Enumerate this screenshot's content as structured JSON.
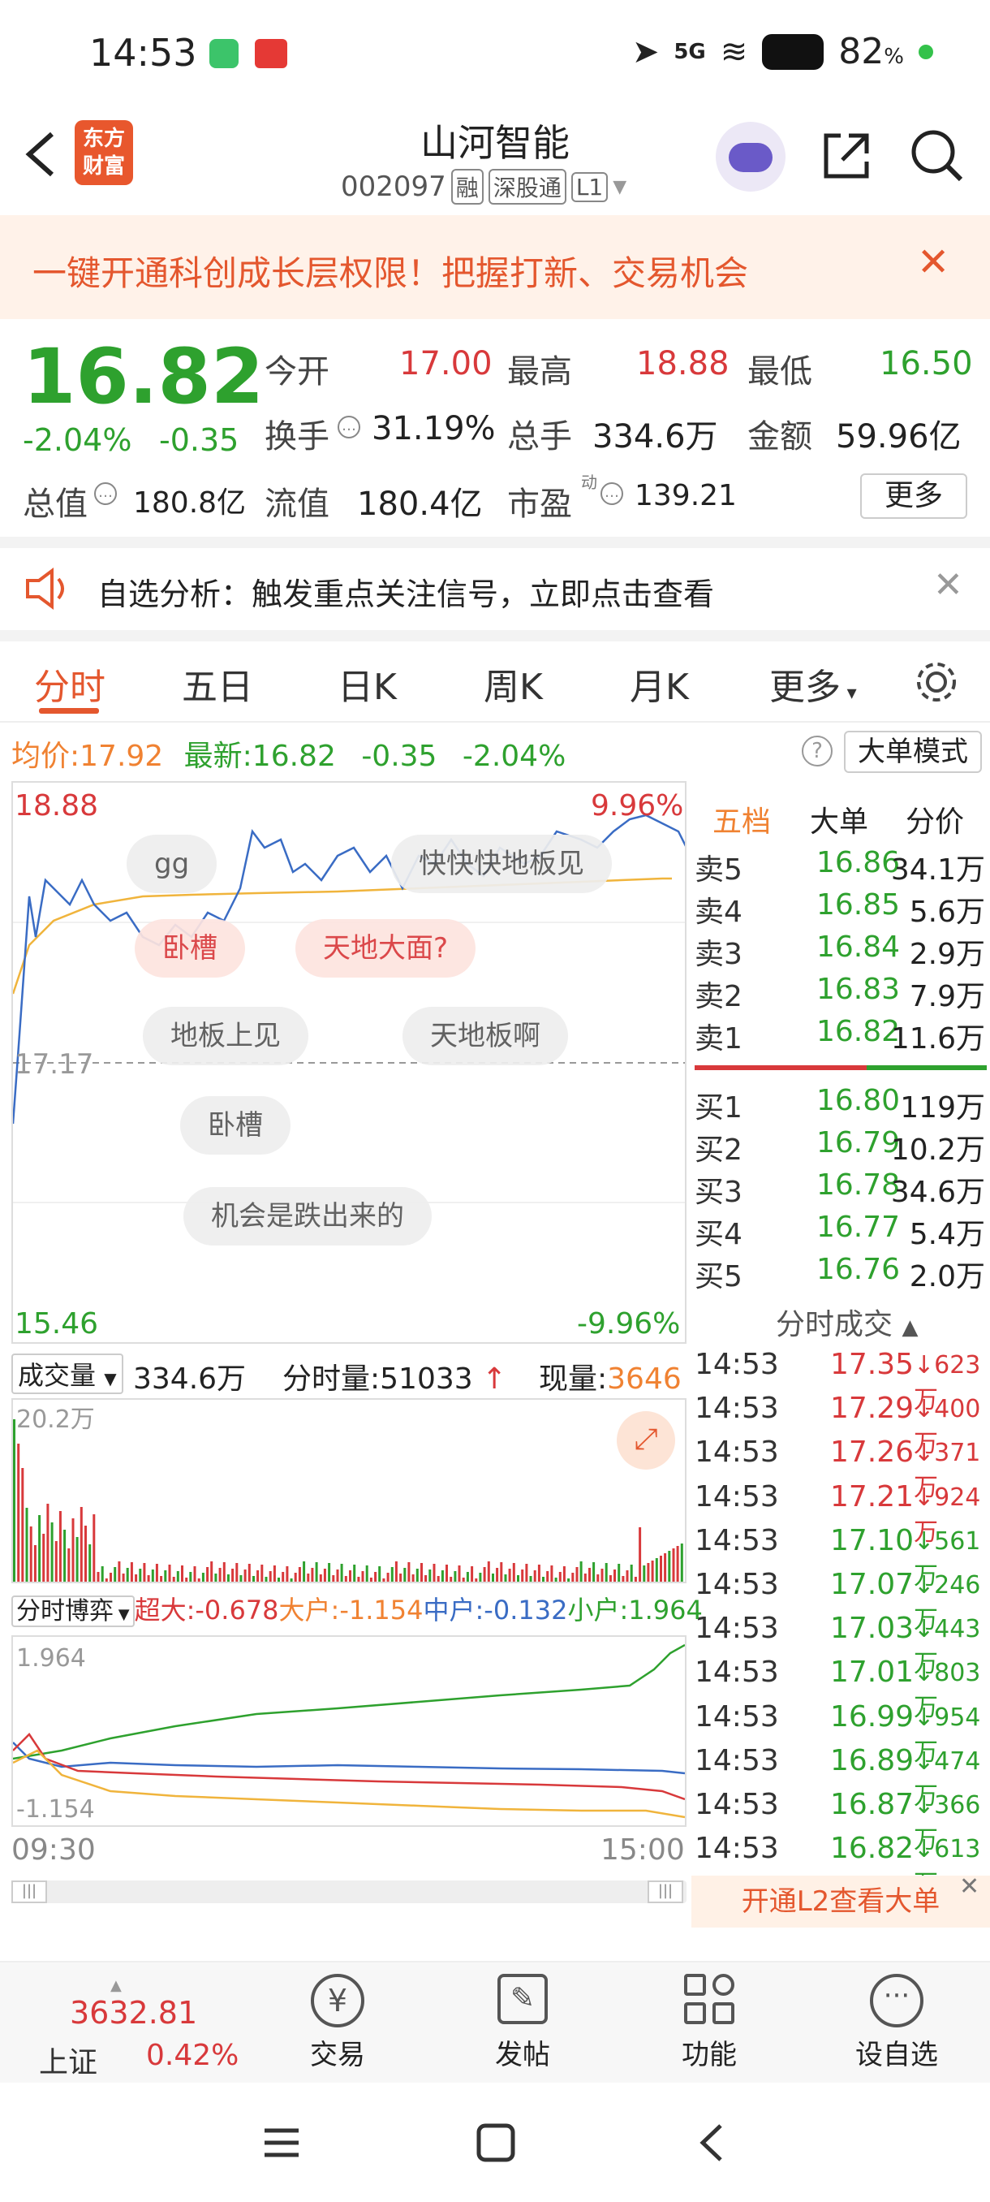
{
  "status": {
    "time": "14:53",
    "signal": "5G",
    "battery": "82",
    "battery_unit": "%"
  },
  "header": {
    "logo": "东方财富",
    "stock_name": "山河智能",
    "stock_code": "002097",
    "tags": [
      "融",
      "深股通",
      "L1"
    ]
  },
  "promo": {
    "text": "一键开通科创成长层权限！把握打新、交易机会"
  },
  "quote": {
    "price": "16.82",
    "change_pct": "-2.04%",
    "change": "-0.35",
    "open_label": "今开",
    "open": "17.00",
    "high_label": "最高",
    "high": "18.88",
    "low_label": "最低",
    "low": "16.50",
    "turnover_label": "换手",
    "turnover": "31.19%",
    "volume_label": "总手",
    "volume": "334.6万",
    "amount_label": "金额",
    "amount": "59.96亿",
    "mktcap_label": "总值",
    "mktcap": "180.8亿",
    "float_label": "流值",
    "float": "180.4亿",
    "pe_label": "市盈",
    "pe_sup": "动",
    "pe": "139.21",
    "more": "更多"
  },
  "notice": {
    "text": "自选分析：触发重点关注信号，立即点击查看"
  },
  "tabs": [
    "分时",
    "五日",
    "日K",
    "周K",
    "月K",
    "更多"
  ],
  "avg": {
    "label": "均价:",
    "value": "17.92",
    "latest_label": "最新:",
    "latest": "16.82",
    "change": "-0.35",
    "pct": "-2.04%",
    "mode": "大单模式"
  },
  "chart": {
    "max": "18.88",
    "max_pct": "9.96%",
    "min": "15.46",
    "min_pct": "-9.96%",
    "ref": "17.17"
  },
  "bubbles": [
    "gg",
    "快快快地板见",
    "卧槽",
    "天地大面?",
    "地板上见",
    "天地板啊",
    "卧槽",
    "机会是跌出来的"
  ],
  "order_book": {
    "tabs": [
      "五档",
      "大单",
      "分价"
    ],
    "sells": [
      {
        "label": "卖5",
        "price": "16.86",
        "vol": "34.1万"
      },
      {
        "label": "卖4",
        "price": "16.85",
        "vol": "5.6万"
      },
      {
        "label": "卖3",
        "price": "16.84",
        "vol": "2.9万"
      },
      {
        "label": "卖2",
        "price": "16.83",
        "vol": "7.9万"
      },
      {
        "label": "卖1",
        "price": "16.82",
        "vol": "11.6万"
      }
    ],
    "buys": [
      {
        "label": "买1",
        "price": "16.80",
        "vol": "119万"
      },
      {
        "label": "买2",
        "price": "16.79",
        "vol": "10.2万"
      },
      {
        "label": "买3",
        "price": "16.78",
        "vol": "34.6万"
      },
      {
        "label": "买4",
        "price": "16.77",
        "vol": "5.4万"
      },
      {
        "label": "买5",
        "price": "16.76",
        "vol": "2.0万"
      }
    ]
  },
  "ticks": {
    "title": "分时成交",
    "rows": [
      {
        "time": "14:53",
        "price": "17.35",
        "vol": "623万",
        "color": "#d8393b"
      },
      {
        "time": "14:53",
        "price": "17.29",
        "vol": "400万",
        "color": "#d8393b"
      },
      {
        "time": "14:53",
        "price": "17.26",
        "vol": "371万",
        "color": "#d8393b"
      },
      {
        "time": "14:53",
        "price": "17.21",
        "vol": "924万",
        "color": "#d8393b"
      },
      {
        "time": "14:53",
        "price": "17.10",
        "vol": "561万",
        "color": "#2ea12e"
      },
      {
        "time": "14:53",
        "price": "17.07",
        "vol": "246万",
        "color": "#2ea12e"
      },
      {
        "time": "14:53",
        "price": "17.03",
        "vol": "443万",
        "color": "#2ea12e"
      },
      {
        "time": "14:53",
        "price": "17.01",
        "vol": "803万",
        "color": "#2ea12e"
      },
      {
        "time": "14:53",
        "price": "16.99",
        "vol": "954万",
        "color": "#2ea12e"
      },
      {
        "time": "14:53",
        "price": "16.89",
        "vol": "474万",
        "color": "#2ea12e"
      },
      {
        "time": "14:53",
        "price": "16.87",
        "vol": "366万",
        "color": "#2ea12e"
      },
      {
        "time": "14:53",
        "price": "16.82",
        "vol": "613万",
        "color": "#2ea12e"
      }
    ],
    "l2": "开通L2查看大单"
  },
  "volume": {
    "label": "成交量",
    "total": "334.6万",
    "minute_label": "分时量:",
    "minute": "51033",
    "now_label": "现量:",
    "now": "3646",
    "axis_max": "20.2万"
  },
  "flow": {
    "label": "分时博弈",
    "super_label": "超大:",
    "super": "-0.678",
    "big_label": "大户:",
    "big": "-1.154",
    "mid_label": "中户:",
    "mid": "-0.132",
    "small_label": "小户:",
    "small": "1.964",
    "axis_max": "1.964",
    "axis_min": "-1.154",
    "time_start": "09:30",
    "time_end": "15:00"
  },
  "index": {
    "value": "3632.81",
    "name": "上证",
    "pct": "0.42%"
  },
  "bottom_nav": [
    "交易",
    "发帖",
    "功能",
    "设自选"
  ]
}
